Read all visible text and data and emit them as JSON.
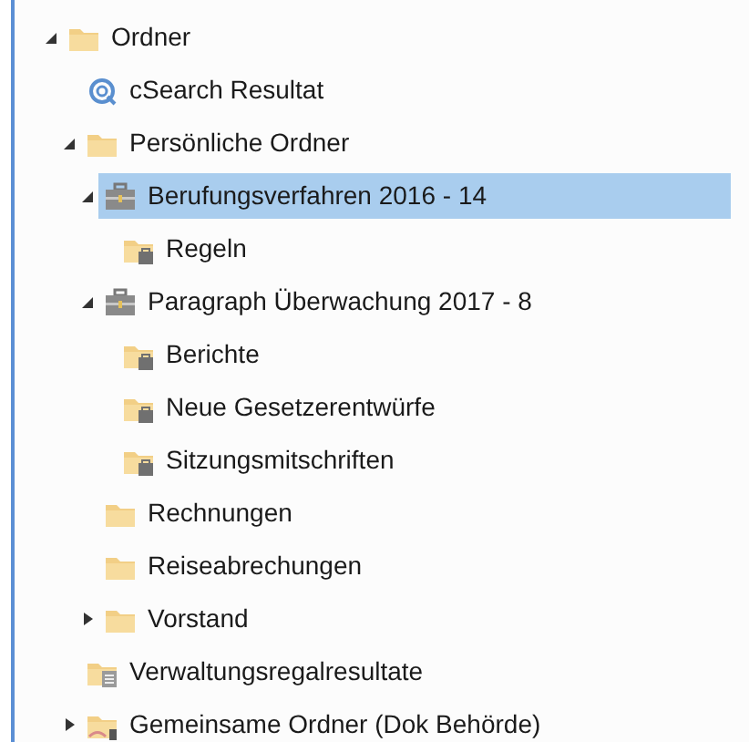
{
  "tree": [
    {
      "label": "Ordner",
      "kind": "folder",
      "expanded": true,
      "selected": false,
      "children": [
        {
          "label": "cSearch Resultat",
          "kind": "search",
          "selected": false
        },
        {
          "label": "Persönliche Ordner",
          "kind": "folder",
          "expanded": true,
          "selected": false,
          "children": [
            {
              "label": "Berufungsverfahren 2016 - 14",
              "kind": "case",
              "expanded": true,
              "selected": true,
              "children": [
                {
                  "label": "Regeln",
                  "kind": "case-folder",
                  "selected": false
                }
              ]
            },
            {
              "label": "Paragraph Überwachung 2017 - 8",
              "kind": "case",
              "expanded": true,
              "selected": false,
              "children": [
                {
                  "label": "Berichte",
                  "kind": "case-folder",
                  "selected": false
                },
                {
                  "label": "Neue Gesetzerentwürfe",
                  "kind": "case-folder",
                  "selected": false
                },
                {
                  "label": "Sitzungsmitschriften",
                  "kind": "case-folder",
                  "selected": false
                }
              ]
            },
            {
              "label": "Rechnungen",
              "kind": "folder",
              "selected": false
            },
            {
              "label": "Reiseabrechungen",
              "kind": "folder",
              "selected": false
            },
            {
              "label": "Vorstand",
              "kind": "folder",
              "expanded": false,
              "selected": false
            }
          ]
        },
        {
          "label": "Verwaltungsregalresultate",
          "kind": "result-folder",
          "selected": false
        },
        {
          "label": "Gemeinsame Ordner (Dok Behörde)",
          "kind": "shared-folder",
          "expanded": false,
          "selected": false
        }
      ]
    }
  ]
}
